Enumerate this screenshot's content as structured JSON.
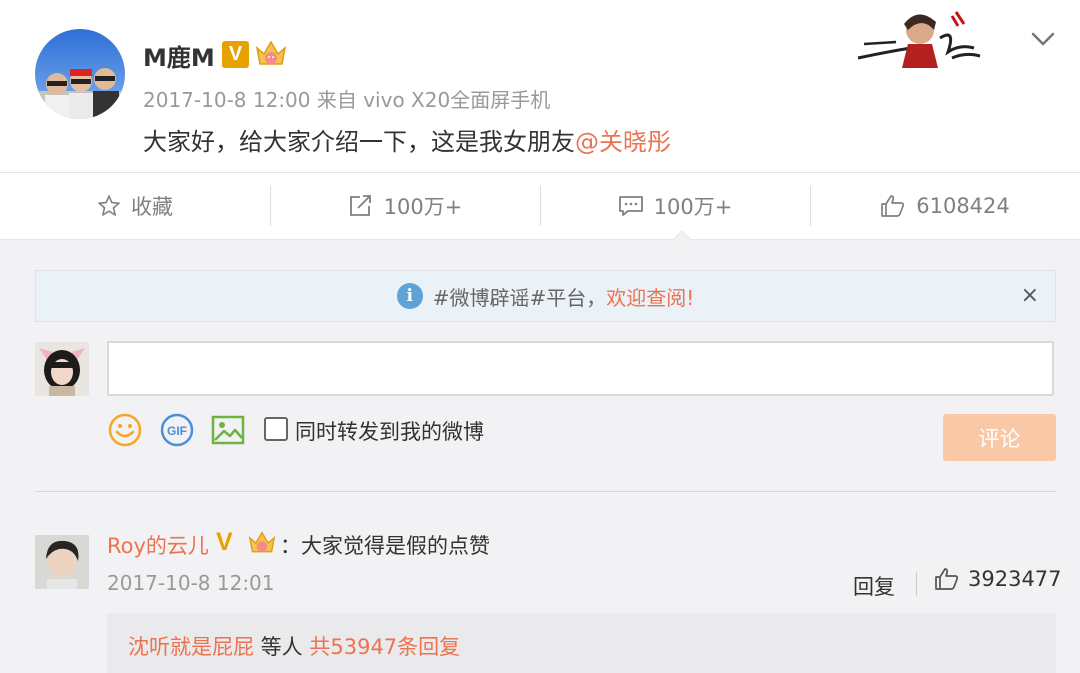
{
  "post": {
    "username": "M鹿M",
    "verified_badge": "V",
    "timestamp": "2017-10-8 12:00",
    "source_prefix": "来自",
    "source_device": "vivo X20全面屏手机",
    "text": "大家好，给大家介绍一下，这是我女朋友",
    "mention": "@关晓彤"
  },
  "actions": {
    "favorite": "收藏",
    "repost": "100万+",
    "comment": "100万+",
    "like": "6108424"
  },
  "notice": {
    "prefix": "#微博辟谣#平台，",
    "link": "欢迎查阅!",
    "close": "×"
  },
  "composer": {
    "input_value": "",
    "repost_label": "同时转发到我的微博",
    "submit_label": "评论"
  },
  "comment": {
    "username": "Roy的云儿",
    "verified_badge": "V",
    "text": "：大家觉得是假的点赞",
    "timestamp": "2017-10-8 12:01",
    "reply_label": "回复",
    "like_count": "3923477",
    "replies_user": "沈听就是屁屁",
    "replies_middle": " 等人 ",
    "replies_total": "共53947条回复"
  },
  "colors": {
    "accent": "#eb7350",
    "verified": "#e8a200",
    "info": "#5ea3d8",
    "submit_disabled": "#f9c9a7"
  },
  "icons": [
    "star-icon",
    "repost-icon",
    "comment-icon",
    "thumb-up-icon",
    "info-icon",
    "close-icon",
    "smiley-icon",
    "gif-icon",
    "image-icon",
    "chevron-down-icon",
    "crown-icon"
  ]
}
